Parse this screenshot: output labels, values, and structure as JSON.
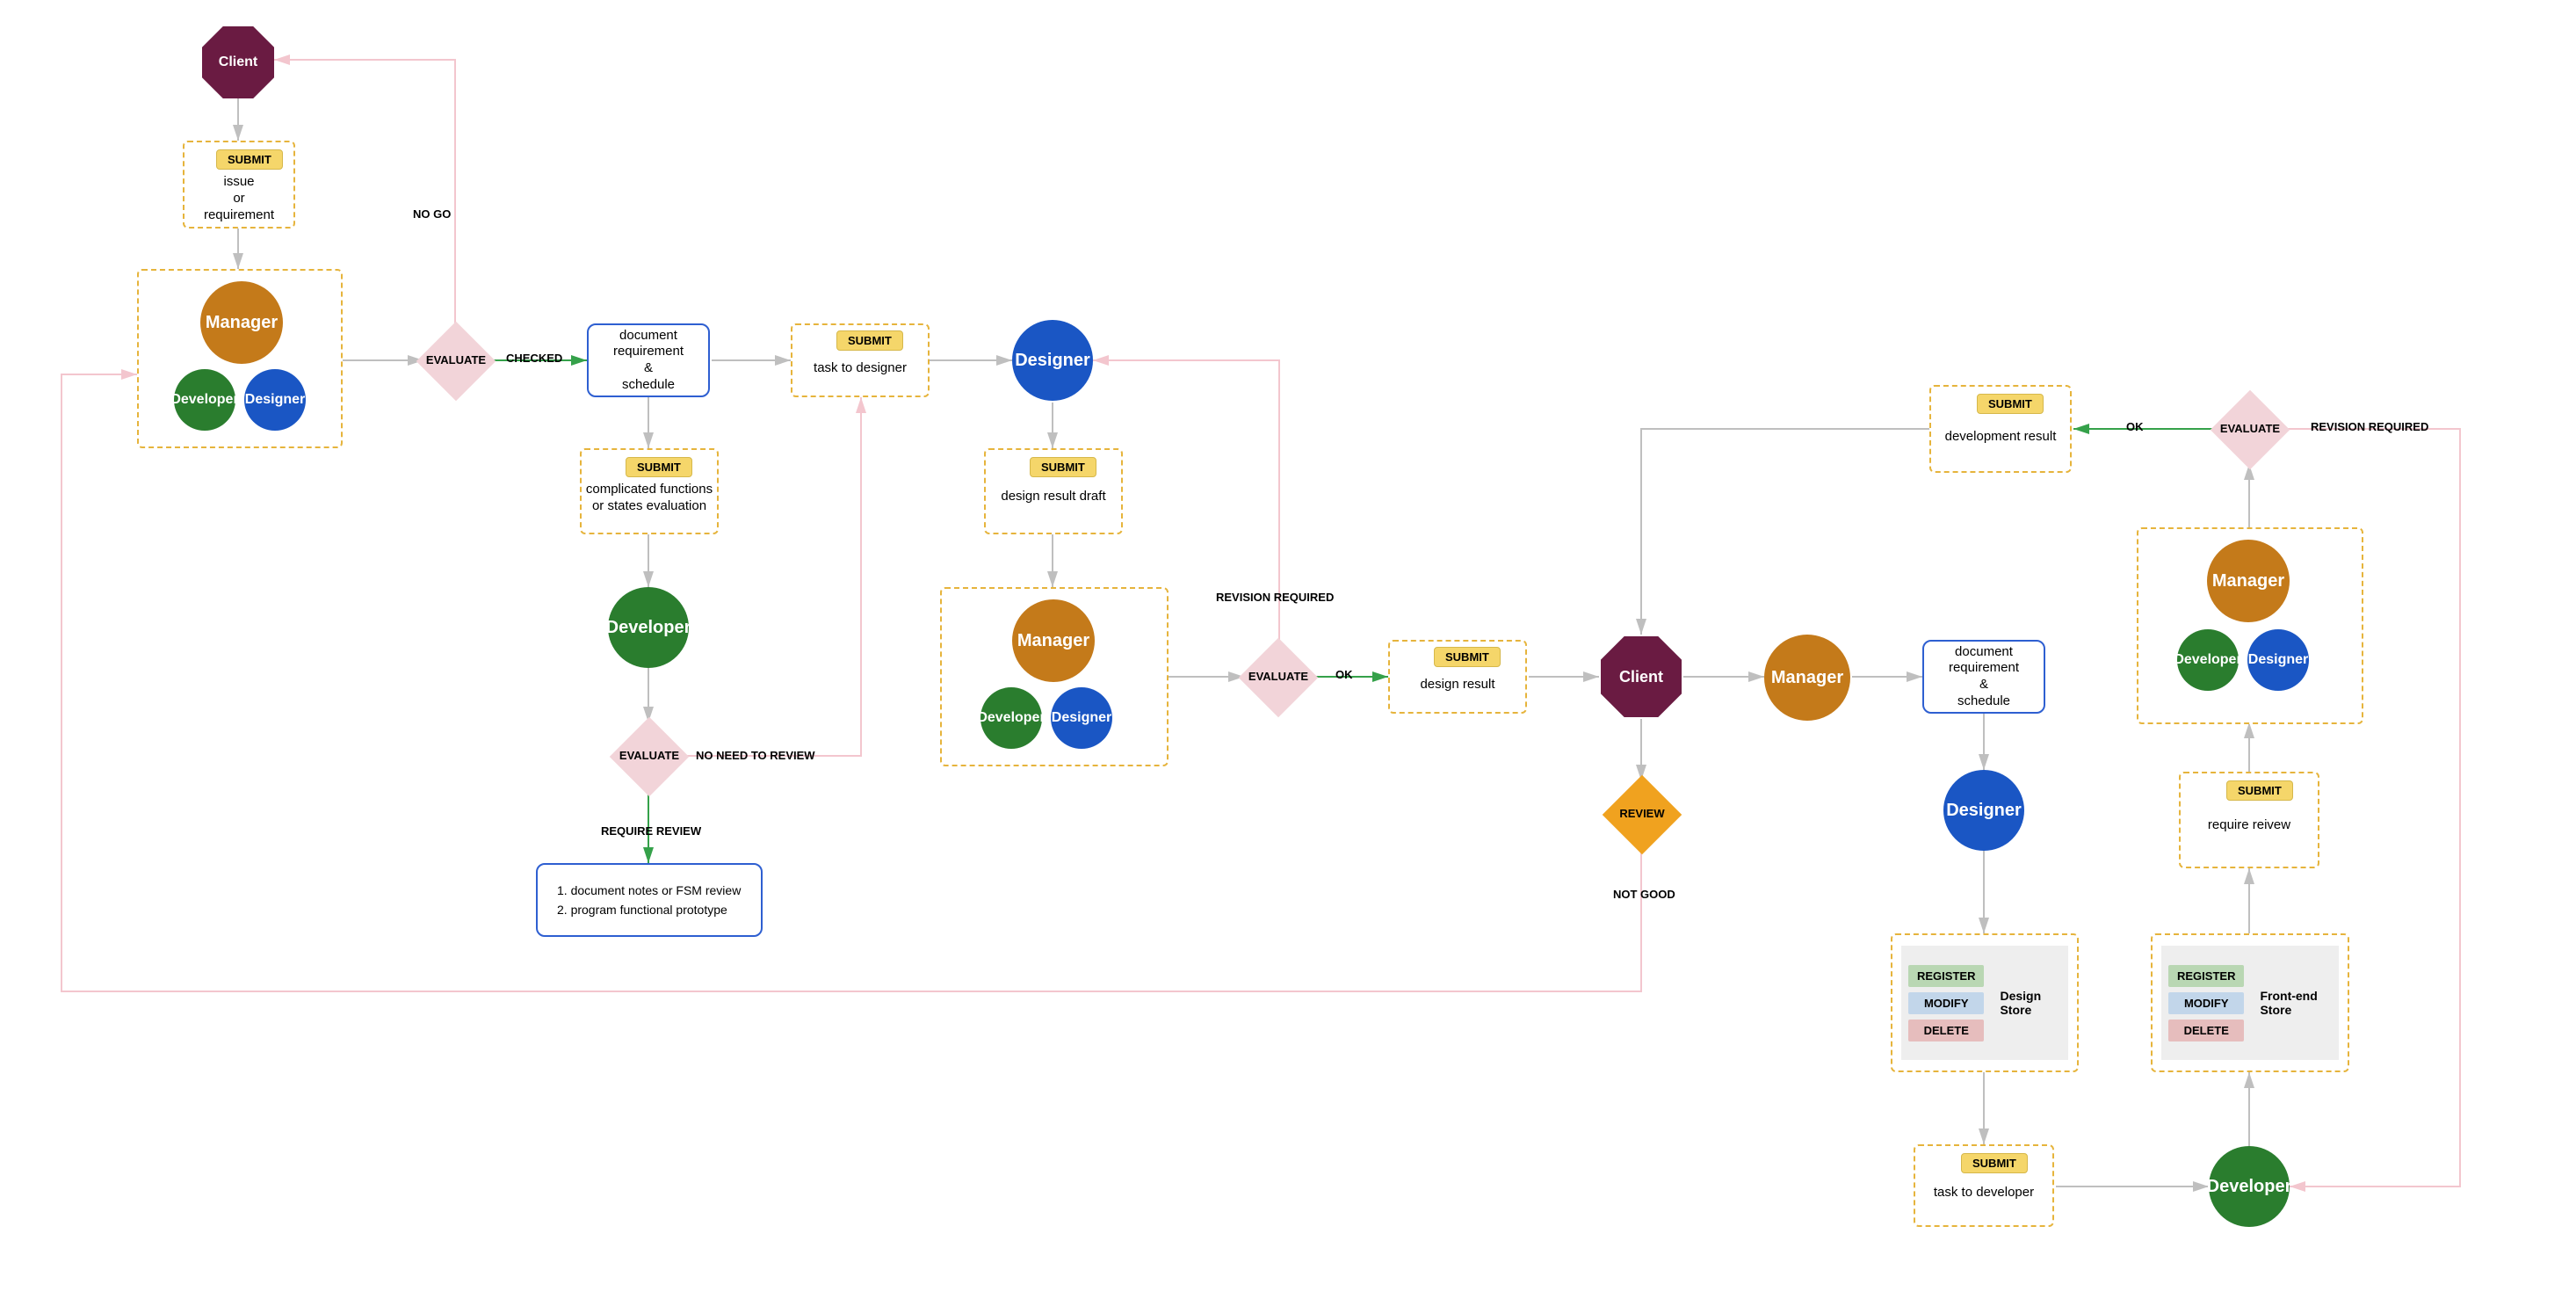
{
  "roles": {
    "client": "Client",
    "manager": "Manager",
    "developer": "Developer",
    "designer": "Designer"
  },
  "decisions": {
    "evaluate": "EVALUATE",
    "review": "REVIEW"
  },
  "tags": {
    "submit": "SUBMIT"
  },
  "edge_labels": {
    "no_go": "NO GO",
    "checked": "CHECKED",
    "no_need_review": "NO NEED TO REVIEW",
    "require_review": "REQUIRE REVIEW",
    "ok": "OK",
    "revision_required": "REVISION REQUIRED",
    "not_good": "NOT GOOD"
  },
  "texts": {
    "issue_or_requirement": "issue\nor\nrequirement",
    "doc_req_schedule": "document\nrequirement\n&\nschedule",
    "complicated_eval": "complicated functions\nor states evaluation",
    "task_to_designer": "task to designer",
    "design_result_draft": "design result draft",
    "design_result": "design result",
    "development_result": "development result",
    "require_review": "require reivew",
    "task_to_developer": "task to developer",
    "review_list_1": "1. document notes or FSM review",
    "review_list_2": "2. program functional prototype"
  },
  "stores": {
    "register": "REGISTER",
    "modify": "MODIFY",
    "delete": "DELETE",
    "design_store": "Design Store",
    "frontend_store": "Front-end Store"
  },
  "colors": {
    "manager": "#c47a1a",
    "developer": "#2a7d2e",
    "designer": "#1a56c4",
    "client": "#6a1b42"
  }
}
